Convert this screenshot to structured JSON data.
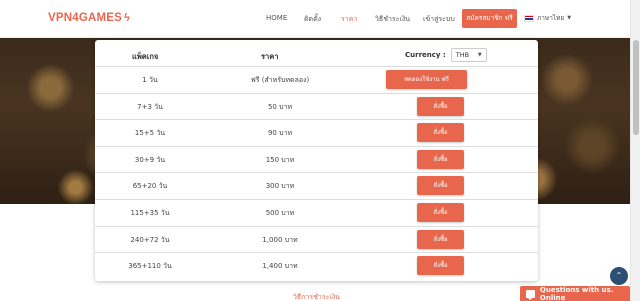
{
  "brand": {
    "name": "VPN4GAMES",
    "bolt": "ϟ"
  },
  "nav": {
    "items": [
      {
        "label": "HOME",
        "active": false
      },
      {
        "label": "ติดตั้ง",
        "active": false
      },
      {
        "label": "ราคา",
        "active": true
      },
      {
        "label": "วิธีชำระเงิน",
        "active": false
      },
      {
        "label": "เข้าสู่ระบบ",
        "active": false
      }
    ],
    "cta": "สมัครสมาชิก ฟรี",
    "language": {
      "label": "ภาษาไทย",
      "caret": "▼"
    }
  },
  "table": {
    "headers": {
      "package": "แพ็คเกจ",
      "price": "ราคา"
    },
    "currency": {
      "label": "Currency :",
      "value": "THB",
      "caret": "▼"
    },
    "rows": [
      {
        "package": "1 วัน",
        "price": "ฟรี (สำหรับทดลอง)",
        "button": "ทดลองใช้งาน ฟรี"
      },
      {
        "package": "7+3 วัน",
        "price": "50 บาท",
        "button": "สั่งซื้อ"
      },
      {
        "package": "15+5 วัน",
        "price": "90 บาท",
        "button": "สั่งซื้อ"
      },
      {
        "package": "30+9 วัน",
        "price": "150 บาท",
        "button": "สั่งซื้อ"
      },
      {
        "package": "65+20 วัน",
        "price": "300 บาท",
        "button": "สั่งซื้อ"
      },
      {
        "package": "115+35 วัน",
        "price": "500 บาท",
        "button": "สั่งซื้อ"
      },
      {
        "package": "240+72 วัน",
        "price": "1,000 บาท",
        "button": "สั่งซื้อ"
      },
      {
        "package": "365+110 วัน",
        "price": "1,400 บาท",
        "button": "สั่งซื้อ"
      }
    ]
  },
  "footer_link": "วิธีการชำระเงิน",
  "scroll_up": "⌃",
  "chat": {
    "label": "Questions with us. Online"
  },
  "colors": {
    "accent": "#e8664b",
    "navy": "#2d4f73"
  }
}
